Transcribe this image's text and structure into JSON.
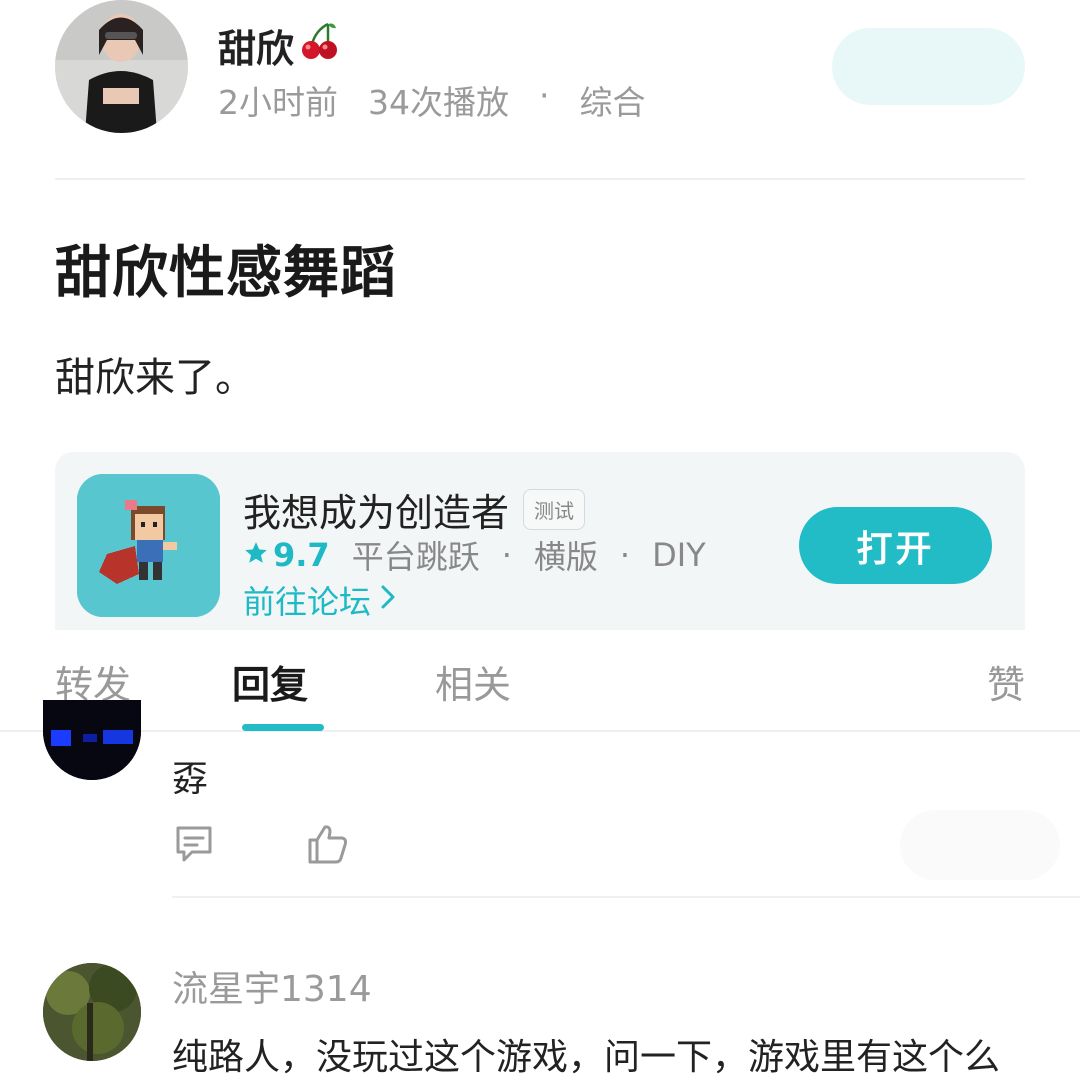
{
  "author": {
    "name": "甜欣",
    "name_emoji": "cherry-icon",
    "time": "2小时前",
    "plays": "34次播放",
    "sep": "·",
    "category": "综合"
  },
  "post": {
    "title": "甜欣性感舞蹈",
    "body": "甜欣来了。"
  },
  "game_card": {
    "name": "我想成为创造者",
    "badge": "测试",
    "rating": "9.7",
    "tag1": "平台跳跃",
    "tag2": "横版",
    "tag3": "DIY",
    "sep": "·",
    "forum_link": "前往论坛",
    "open_label": "打开",
    "accent": "#22bcc7"
  },
  "tabs": {
    "repost": "转发",
    "reply": "回复",
    "related": "相关",
    "likes": "赞",
    "active": "回复"
  },
  "comments": [
    {
      "text": "孬"
    },
    {
      "username": "流星宇1314",
      "text": "纯路人，没玩过这个游戏，问一下，游戏里有这个么"
    }
  ]
}
